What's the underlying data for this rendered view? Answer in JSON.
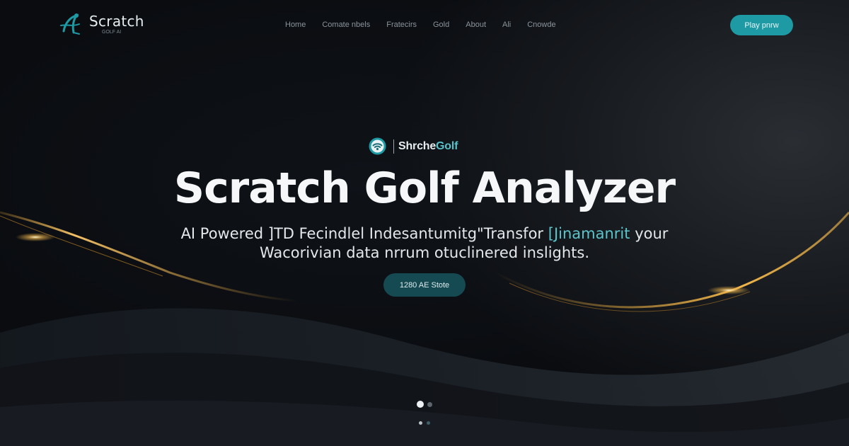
{
  "brand": {
    "name": "Scratch",
    "tagline": "GOLF AI",
    "accent": "#1d9aa4"
  },
  "nav": {
    "items": [
      "Home",
      "Comate nbels",
      "Fratecirs",
      "Gold",
      "About",
      "Ali",
      "Cnowde"
    ]
  },
  "header": {
    "play_label": "Play pnrw"
  },
  "hero": {
    "badge_part1": "Shrche",
    "badge_part2": "Golf",
    "title": "Scratch Golf Analyzer",
    "subtitle_line1_a": "AI Powered ]TD Fecindlel Indesantumitg\"Transfor",
    "subtitle_line1_teal": "[Jinamanrit",
    "subtitle_line1_b": "your",
    "subtitle_line2": "Wacorivian data nrrum otuclinered inslights.",
    "cta_label": "1280 AE Stote"
  },
  "carousel": {
    "active_index": 0,
    "count": 2
  },
  "colors": {
    "background": "#0b0e12",
    "gold_streak": "#e6a93a",
    "teal": "#57c2c9"
  }
}
